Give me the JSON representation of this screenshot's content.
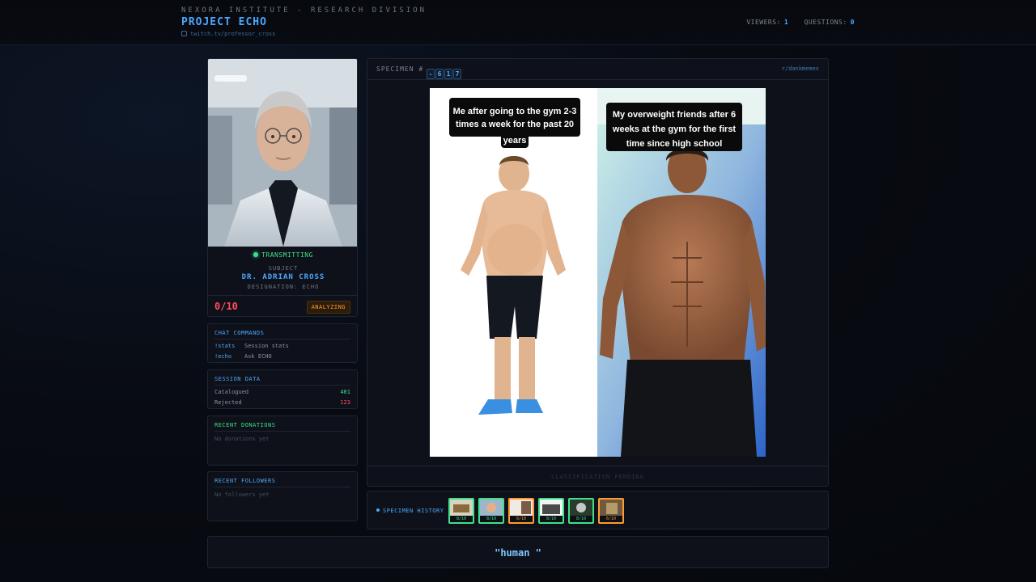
{
  "header": {
    "org": "NEXORA INSTITUTE - RESEARCH DIVISION",
    "project": "PROJECT ECHO",
    "channel": "twitch.tv/professor_cross",
    "viewers_label": "VIEWERS:",
    "viewers_value": "1",
    "questions_label": "QUESTIONS:",
    "questions_value": "0"
  },
  "subject": {
    "status": "TRANSMITTING",
    "label": "SUBJECT",
    "name": "DR. ADRIAN CROSS",
    "designation": "DESIGNATION: ECHO",
    "score": "0/10",
    "badge": "ANALYZING"
  },
  "commands": {
    "title": "CHAT COMMANDS",
    "items": [
      {
        "key": "!stats",
        "desc": "Session stats"
      },
      {
        "key": "!echo",
        "desc": "Ask ECHO"
      }
    ]
  },
  "session": {
    "title": "SESSION DATA",
    "rows": [
      {
        "label": "Catalogued",
        "value": "401",
        "color": "#3fe08a"
      },
      {
        "label": "Rejected",
        "value": "123",
        "color": "#ff4d5e"
      }
    ]
  },
  "donations": {
    "title": "RECENT DONATIONS",
    "empty": "No donations yet",
    "color": "#3fe08a"
  },
  "followers": {
    "title": "RECENT FOLLOWERS",
    "empty": "No followers yet",
    "color": "#4aa8ff"
  },
  "specimen": {
    "label": "SPECIMEN #",
    "digits": [
      "-",
      "6",
      "1",
      "7"
    ],
    "source": "r/dankmemes",
    "meme_left_caption": [
      "Me after going to the gym 2-3",
      "times a week for the past 20",
      "years"
    ],
    "meme_right_caption": [
      "My overweight friends after 6",
      "weeks at the gym for the first",
      "time since high school"
    ],
    "footer": "CLASSIFICATION PENDING"
  },
  "history": {
    "label": "SPECIMEN HISTORY",
    "thumbs": [
      {
        "score": "8/10",
        "state": "ok"
      },
      {
        "score": "8/10",
        "state": "ok"
      },
      {
        "score": "6/10",
        "state": "warn"
      },
      {
        "score": "8/10",
        "state": "ok"
      },
      {
        "score": "8/10",
        "state": "ok"
      },
      {
        "score": "6/10",
        "state": "warn"
      }
    ]
  },
  "transcript": {
    "text": "\"human \""
  },
  "colors": {
    "accent": "#4aa8ff",
    "success": "#3fe08a",
    "danger": "#ff4d5e",
    "warning": "#ff9b2e"
  }
}
